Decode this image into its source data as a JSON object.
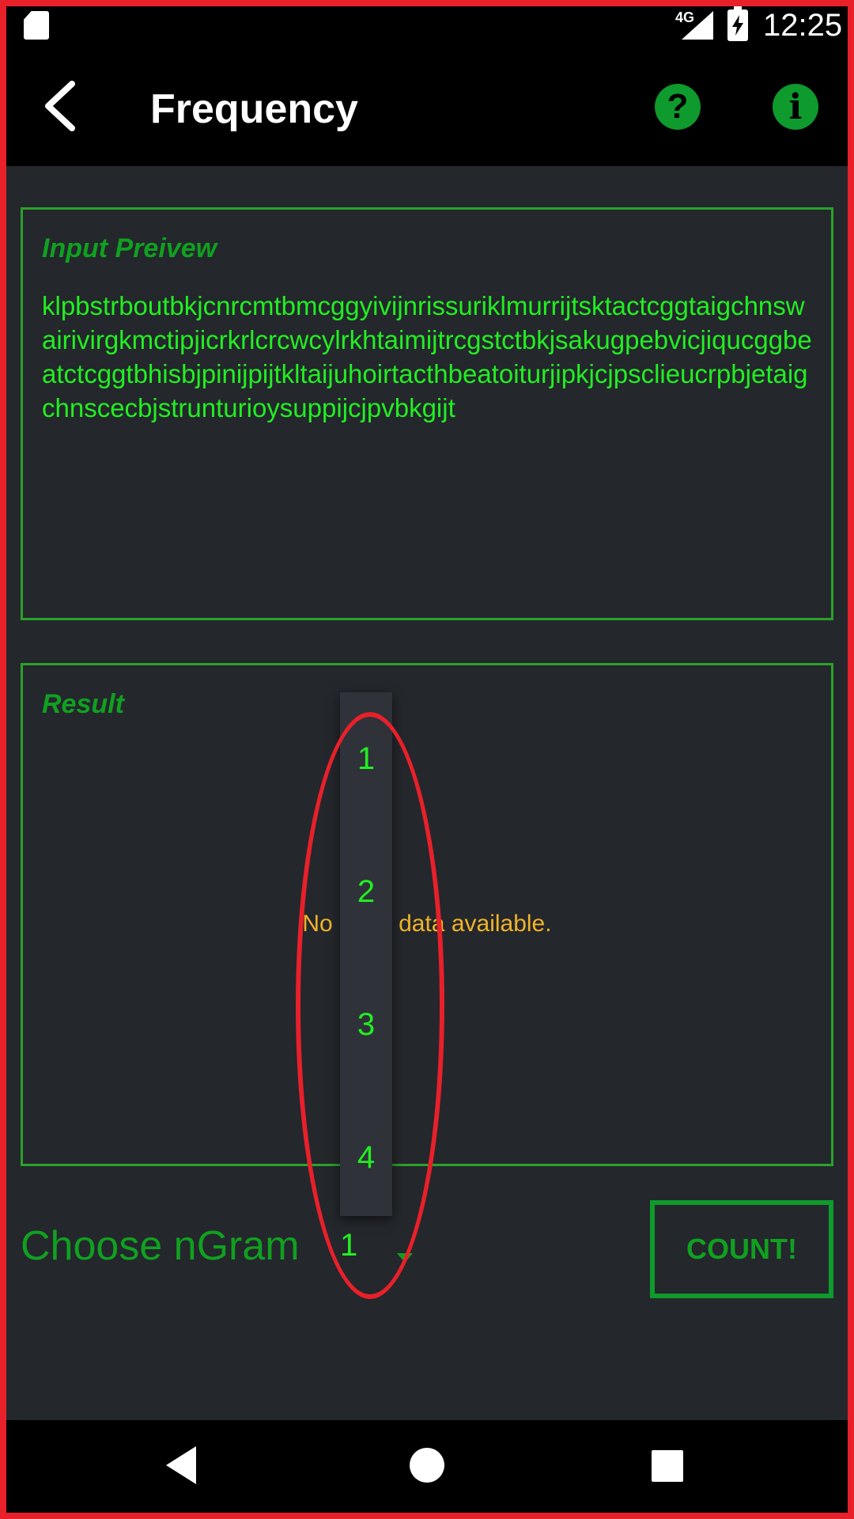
{
  "status_bar": {
    "network": "4G",
    "time": "12:25"
  },
  "app_bar": {
    "title": "Frequency"
  },
  "input_panel": {
    "title": "Input Preivew",
    "text": "klpbstrboutbkjcnrcmtbmcggyivijnrissuriklmurrijtsktactcggtaigchnswairivirgkmctipjicrkrlcrcwcylrkhtaimijtrcgstctbkjsakugpebvicjiqucggbeatctcggtbhisbjpinijpijtkltaijuhoirtacthbeatoiturjipkjcjpsclieucrpbjetaigchnscecbjstrunturioysuppijcjpvbkgijt"
  },
  "result_panel": {
    "title": "Result",
    "empty_message": "No chart data available."
  },
  "ngram": {
    "label": "Choose nGram",
    "selected": "1",
    "options": [
      "1",
      "2",
      "3",
      "4"
    ]
  },
  "count_button": {
    "label": "COUNT!"
  },
  "colors": {
    "accent_green": "#0e9a2c",
    "text_green": "#22ee22",
    "warning_yellow": "#f0b428",
    "annotation_red": "#e8202a",
    "background": "#24272c"
  },
  "icons": {
    "back": "back-arrow-icon",
    "help": "question-circle-icon",
    "info": "info-circle-icon"
  }
}
